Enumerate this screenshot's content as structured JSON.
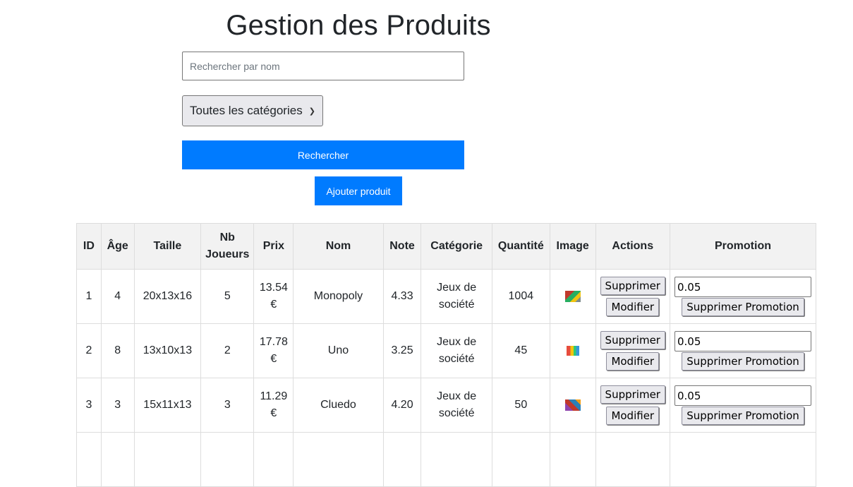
{
  "header": {
    "title": "Gestion des Produits"
  },
  "search": {
    "placeholder": "Rechercher par nom",
    "value": ""
  },
  "category_select": {
    "selected": "Toutes les catégories"
  },
  "buttons": {
    "search": "Rechercher",
    "add_product": "Ajouter produit"
  },
  "table": {
    "headers": {
      "id": "ID",
      "age": "Âge",
      "size": "Taille",
      "nb_players_line1": "Nb",
      "nb_players_line2": "Joueurs",
      "price": "Prix",
      "name": "Nom",
      "rating": "Note",
      "category": "Catégorie",
      "quantity": "Quantité",
      "image": "Image",
      "actions": "Actions",
      "promotion": "Promotion"
    },
    "action_labels": {
      "delete": "Supprimer",
      "edit": "Modifier",
      "remove_promo": "Supprimer Promotion"
    },
    "rows": [
      {
        "id": "1",
        "age": "4",
        "size": "20x13x16",
        "players": "5",
        "price_value": "13.54",
        "currency": "€",
        "name": "Monopoly",
        "rating": "4.33",
        "category_line1": "Jeux de",
        "category_line2": "société",
        "quantity": "1004",
        "image_icon": "monopoly-box-thumbnail",
        "promotion": "0.05"
      },
      {
        "id": "2",
        "age": "8",
        "size": "13x10x13",
        "players": "2",
        "price_value": "17.78",
        "currency": "€",
        "name": "Uno",
        "rating": "3.25",
        "category_line1": "Jeux de",
        "category_line2": "société",
        "quantity": "45",
        "image_icon": "uno-cards-thumbnail",
        "promotion": "0.05"
      },
      {
        "id": "3",
        "age": "3",
        "size": "15x11x13",
        "players": "3",
        "price_value": "11.29",
        "currency": "€",
        "name": "Cluedo",
        "rating": "4.20",
        "category_line1": "Jeux de",
        "category_line2": "société",
        "quantity": "50",
        "image_icon": "cluedo-box-thumbnail",
        "promotion": "0.05"
      }
    ]
  },
  "colors": {
    "primary": "#007bff",
    "header_bg": "#f2f2f2",
    "border": "#dddddd"
  }
}
